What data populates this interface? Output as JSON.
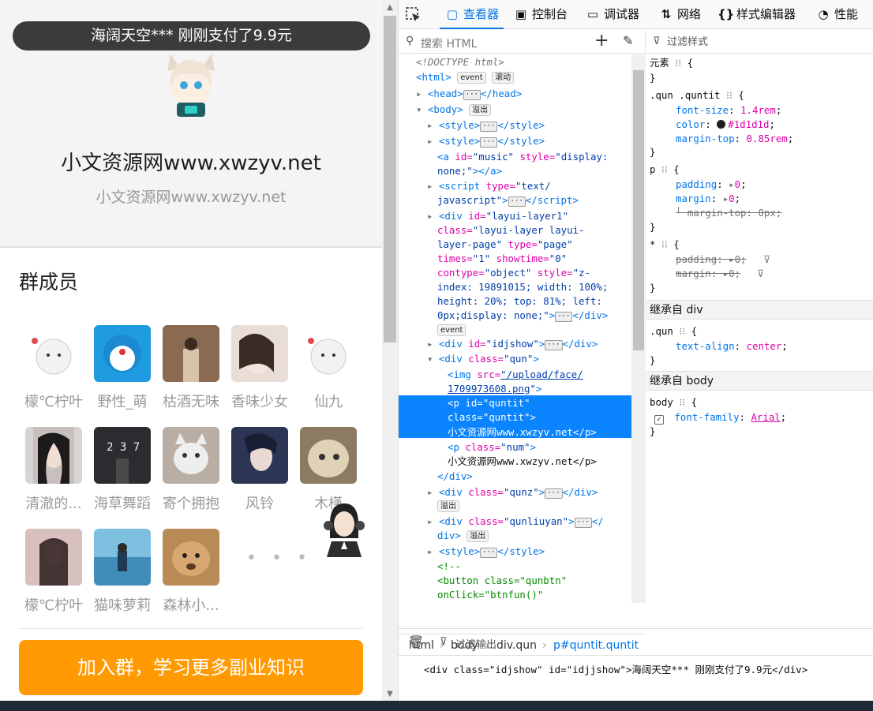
{
  "page": {
    "toast": "海阔天空*** 刚刚支付了9.9元",
    "group_title": "小文资源网www.xwzyv.net",
    "group_num": "小文资源网www.xwzyv.net",
    "members_title": "群成员",
    "members": [
      "檬℃柠叶",
      "野性_萌",
      "枯酒无味",
      "香味少女",
      "仙九",
      "清澈的...",
      "海草舞蹈",
      "寄个拥抱",
      "风铃",
      "木槿",
      "檬℃柠叶",
      "猫味萝莉",
      "森林小..."
    ],
    "more": "• • •",
    "join_button": "加入群，学习更多副业知识"
  },
  "devtools": {
    "tabs": [
      "查看器",
      "控制台",
      "调试器",
      "网络",
      "样式编辑器",
      "性能"
    ],
    "search_placeholder": "搜索 HTML",
    "rules_filter": "过滤样式",
    "console_filter": "过滤输出",
    "console_output": "<div class=\"idjshow\" id=\"idjjshow\">海阔天空*** 刚刚支付了9.9元</div>",
    "breadcrumb": [
      "html",
      "body",
      "div.qun",
      "p#quntit.quntit"
    ],
    "inherit_div": "继承自 div",
    "inherit_body": "继承自 body",
    "element_rule": "元素",
    "badges": {
      "event": "event",
      "scroll": "滚动",
      "overflow": "溢出"
    },
    "selected_text": "小文资源网www.xwzyv.net</p>",
    "num_text": "小文资源网www.xwzyv.net</p>"
  },
  "colors": {
    "toast_bg": "#3b3b3b",
    "join_btn": "#ff9a02",
    "devtools_accent": "#0074e8",
    "selection": "#0a84ff"
  }
}
